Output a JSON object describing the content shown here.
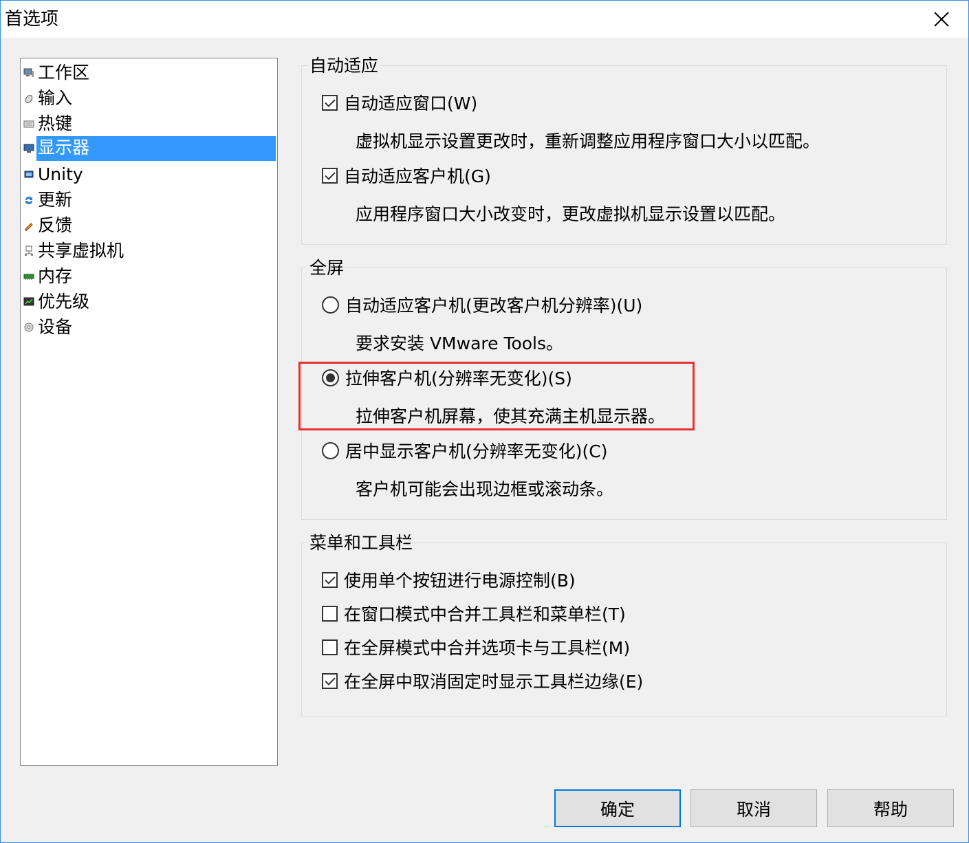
{
  "window": {
    "title": "首选项"
  },
  "sidebar": {
    "items": [
      {
        "label": "工作区",
        "icon": "workspace-icon"
      },
      {
        "label": "输入",
        "icon": "mouse-icon"
      },
      {
        "label": "热键",
        "icon": "keyboard-icon"
      },
      {
        "label": "显示器",
        "icon": "monitor-icon",
        "selected": true
      },
      {
        "label": "Unity",
        "icon": "unity-icon"
      },
      {
        "label": "更新",
        "icon": "update-icon"
      },
      {
        "label": "反馈",
        "icon": "feedback-icon"
      },
      {
        "label": "共享虚拟机",
        "icon": "shared-vm-icon"
      },
      {
        "label": "内存",
        "icon": "memory-icon"
      },
      {
        "label": "优先级",
        "icon": "priority-icon"
      },
      {
        "label": "设备",
        "icon": "device-icon"
      }
    ]
  },
  "autofit": {
    "title": "自动适应",
    "window_label": "自动适应窗口(W)",
    "window_checked": true,
    "window_desc": "虚拟机显示设置更改时，重新调整应用程序窗口大小以匹配。",
    "guest_label": "自动适应客户机(G)",
    "guest_checked": true,
    "guest_desc": "应用程序窗口大小改变时，更改虚拟机显示设置以匹配。"
  },
  "fullscreen": {
    "title": "全屏",
    "opt1_label": "自动适应客户机(更改客户机分辨率)(U)",
    "opt1_desc": "要求安装 VMware Tools。",
    "opt2_label": "拉伸客户机(分辨率无变化)(S)",
    "opt2_desc": "拉伸客户机屏幕，使其充满主机显示器。",
    "opt3_label": "居中显示客户机(分辨率无变化)(C)",
    "opt3_desc": "客户机可能会出现边框或滚动条。",
    "selected": "opt2"
  },
  "menubar": {
    "title": "菜单和工具栏",
    "opt1_label": "使用单个按钮进行电源控制(B)",
    "opt1_checked": true,
    "opt2_label": "在窗口模式中合并工具栏和菜单栏(T)",
    "opt2_checked": false,
    "opt3_label": "在全屏模式中合并选项卡与工具栏(M)",
    "opt3_checked": false,
    "opt4_label": "在全屏中取消固定时显示工具栏边缘(E)",
    "opt4_checked": true
  },
  "buttons": {
    "ok": "确定",
    "cancel": "取消",
    "help": "帮助"
  },
  "colors": {
    "selection": "#3399ff",
    "highlight_box": "#e63232",
    "default_button_border": "#0078d7"
  }
}
